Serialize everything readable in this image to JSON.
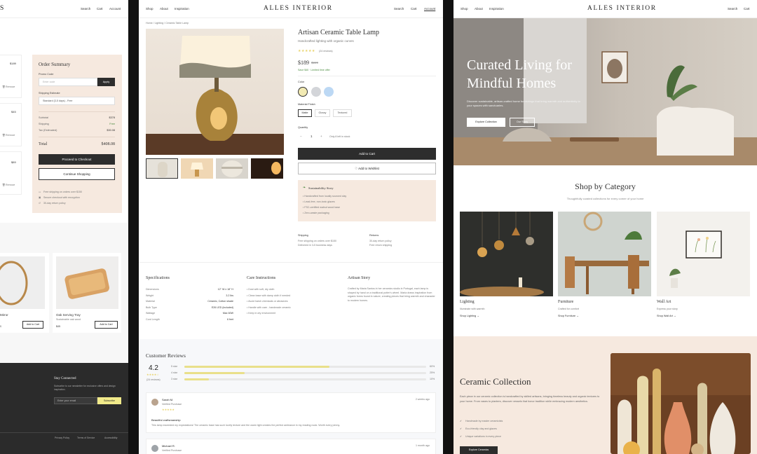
{
  "brand": "ALLES INTERIOR",
  "colors": {
    "accent": "#2d2d2d",
    "cream": "#f6e9df",
    "star": "#e9d36a",
    "green": "#4a8c3f",
    "footer": "#2b2b2b",
    "subscribe": "#f1ea8a"
  },
  "cart": {
    "nav": [
      "Search",
      "Cart",
      "Account"
    ],
    "prices": [
      "$189",
      "$45",
      "$89"
    ],
    "remove_label": "Remove",
    "summary": {
      "title": "Order Summary",
      "promo_label": "Promo Code",
      "promo_placeholder": "Enter code",
      "apply": "Apply",
      "shipping_label": "Shipping Estimate",
      "shipping_option": "Standard (3-5 days) - Free",
      "rows": [
        {
          "label": "Subtotal",
          "value": "$378"
        },
        {
          "label": "Shipping",
          "value": "Free"
        },
        {
          "label": "Tax (Estimated)",
          "value": "$30.08"
        }
      ],
      "total_label": "Total",
      "total_value": "$408.08",
      "checkout": "Proceed to Checkout",
      "continue": "Continue Shopping",
      "notes": [
        "Free shipping on orders over $150",
        "Secure checkout with encryption",
        "30-day return policy"
      ]
    },
    "recs": [
      {
        "name": "Mirror",
        "price": "$",
        "btn": "Add to Cart"
      },
      {
        "name": "Oak Serving Tray",
        "sub": "Sustainable oak wood",
        "price": "$45",
        "btn": "Add to Cart"
      }
    ],
    "footer": {
      "title": "Stay Connected",
      "text": "Subscribe to our newsletter for exclusive offers and design inspiration.",
      "placeholder": "Enter your email",
      "subscribe": "Subscribe",
      "links": [
        "Privacy Policy",
        "Terms of Service",
        "Accessibility"
      ]
    }
  },
  "product": {
    "nav_left": [
      "Shop",
      "About",
      "Inspiration"
    ],
    "nav_right": [
      "Search",
      "Cart",
      "Account"
    ],
    "breadcrumb": "Home / Lighting / Ceramic Table Lamp",
    "title": "Artisan Ceramic Table Lamp",
    "subtitle": "Handcrafted lighting with organic curves",
    "stars": "★★★★★",
    "review_count": "(24 reviews)",
    "price": "$189",
    "old_price": "$229",
    "stock": "Save $40 · Limited time offer",
    "color_label": "Color",
    "finish_label": "Material Finish",
    "finishes": [
      "Matte",
      "Glossy",
      "Textured"
    ],
    "qty_label": "Quantity",
    "qty": "1",
    "stock_note": "Only 8 left in stock",
    "add_to_cart": "Add to Cart",
    "wishlist": "Add to Wishlist",
    "sustain_title": "Sustainability Story",
    "sustain_items": [
      "Handcrafted from locally sourced clay",
      "Lead-free, non-toxic glazes",
      "FSC-certified walnut wood base",
      "Zero-waste packaging"
    ],
    "shipping": {
      "title": "Shipping",
      "lines": [
        "Free shipping on orders over $150",
        "Delivered in 3-5 business days"
      ]
    },
    "returns": {
      "title": "Returns",
      "lines": [
        "30-day return policy",
        "Free return shipping"
      ]
    },
    "spec_title": "Specifications",
    "specs": [
      {
        "k": "Dimensions",
        "v": "12\" W x 18\" H"
      },
      {
        "k": "Weight",
        "v": "3.2 lbs"
      },
      {
        "k": "Material",
        "v": "Ceramic, Cotton shade"
      },
      {
        "k": "Bulb Type",
        "v": "E26 LED (included)"
      },
      {
        "k": "Wattage",
        "v": "Max 60W"
      },
      {
        "k": "Cord Length",
        "v": "6 feet"
      }
    ],
    "care_title": "Care Instructions",
    "care": [
      "Dust with soft, dry cloth",
      "Clean base with damp cloth if needed",
      "Avoid harsh chemicals or abrasives",
      "Handle with care - handmade ceramic",
      "Keep in dry environment"
    ],
    "story_title": "Artisan Story",
    "story": "Crafted by Maria Santos in her ceramics studio in Portugal, each lamp is shaped by hand on a traditional potter's wheel. Maria draws inspiration from organic forms found in nature, creating pieces that bring warmth and character to modern homes.",
    "reviews_title": "Customer Reviews",
    "rating": "4.2",
    "rating_stars": "★★★★☆",
    "rating_count": "(24 reviews)",
    "dist": [
      {
        "label": "5 star",
        "pct": "60%",
        "value": 0.6
      },
      {
        "label": "4 star",
        "pct": "25%",
        "value": 0.25
      },
      {
        "label": "3 star",
        "pct": "10%",
        "value": 0.1
      }
    ],
    "reviews": [
      {
        "name": "Sarah M.",
        "tag": "Verified Purchase",
        "date": "2 weeks ago",
        "stars": "★★★★★",
        "title": "Beautiful craftsmanship",
        "text": "This lamp exceeded my expectations! The ceramic base has such lovely texture and the warm light creates the perfect ambiance in my reading nook. Worth every penny."
      },
      {
        "name": "Michael R.",
        "tag": "Verified Purchase",
        "date": "1 month ago"
      }
    ]
  },
  "home": {
    "nav_left": [
      "Shop",
      "About",
      "Inspiration"
    ],
    "nav_right": [
      "Search",
      "Cart"
    ],
    "hero_title_1": "Curated Living for",
    "hero_title_2": "Mindful Homes",
    "hero_text": "Discover sustainable, artisan-crafted home furnishings that bring warmth and authenticity to your spaces with sanctuaries.",
    "explore": "Explore Collection",
    "hero_btn2": "Our Story",
    "cat_title": "Shop by Category",
    "cat_sub": "Thoughtfully curated collections for every corner of your home",
    "cats": [
      {
        "name": "Lighting",
        "sub": "Illuminate with warmth",
        "link": "Shop Lighting →"
      },
      {
        "name": "Furniture",
        "sub": "Crafted for comfort",
        "link": "Shop Furniture →"
      },
      {
        "name": "Wall Art",
        "sub": "Express your story",
        "link": "Shop Wall Art →"
      }
    ],
    "ceramic_title": "Ceramic Collection",
    "ceramic_text": "Each piece in our ceramic collection is handcrafted by skilled artisans, bringing timeless beauty and organic textures to your home. From vases to planters, discover vessels that honor tradition while embracing modern aesthetics.",
    "ceramic_list": [
      "Handmade by master ceramicists",
      "Eco-friendly clay and glazes",
      "Unique variations in every piece"
    ],
    "ceramic_btn": "Explore Ceramics"
  }
}
